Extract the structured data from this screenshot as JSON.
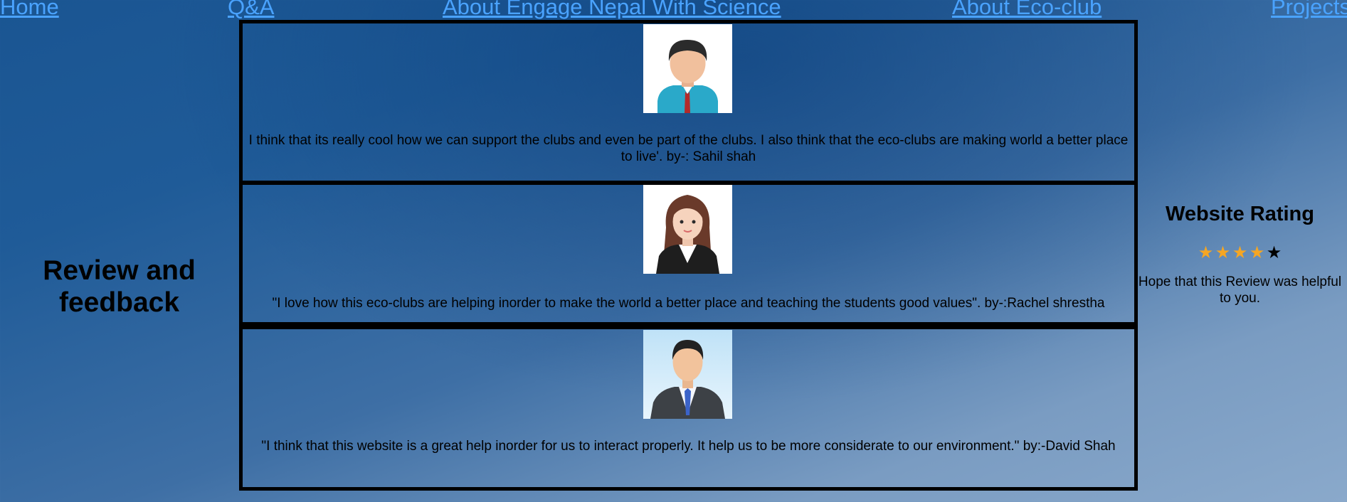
{
  "nav": {
    "items": [
      {
        "label": "Home"
      },
      {
        "label": "Q&A"
      },
      {
        "label": "About Engage Nepal With Science"
      },
      {
        "label": "About Eco-club"
      },
      {
        "label": "Projects"
      }
    ],
    "link_color": "#4aa3ff"
  },
  "left": {
    "heading_line1": "Review and",
    "heading_line2": "feedback"
  },
  "reviews": [
    {
      "avatar": "man-avatar-icon",
      "text": "I think that its really cool how we can support the clubs and even be part of the clubs. I also think that the eco-clubs are making world a better place to live'. by-: Sahil shah"
    },
    {
      "avatar": "woman-avatar-icon",
      "text": "\"I love how this eco-clubs are helping inorder to make the world a better place and teaching the students good values\". by-:Rachel shrestha"
    },
    {
      "avatar": "businessman-avatar-icon",
      "text": "\"I think that this website is a great help inorder for us to interact properly. It help us to be more considerate to our environment.\" by:-David Shah"
    }
  ],
  "rating": {
    "title": "Website Rating",
    "stars_filled": 4,
    "stars_total": 5,
    "star_glyph": "★",
    "filled_color": "#f5a623",
    "empty_color": "#000000",
    "message_line1": "Hope that this Review was helpful",
    "message_line2": "to you."
  }
}
